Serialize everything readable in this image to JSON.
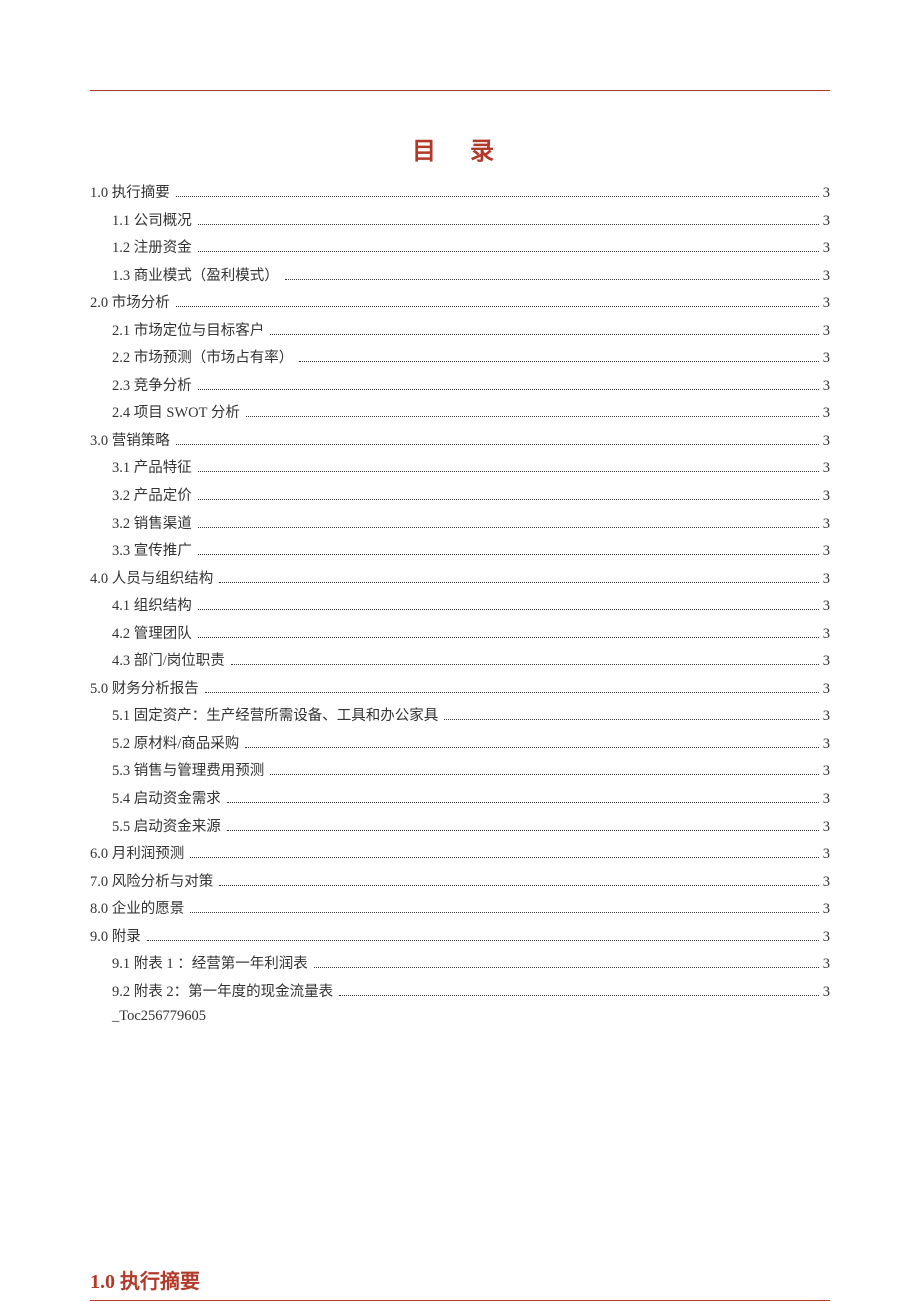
{
  "title": "目 录",
  "toc": [
    {
      "level": 1,
      "label": "1.0 执行摘要",
      "page": "3"
    },
    {
      "level": 2,
      "label": "1.1 公司概况",
      "page": "3"
    },
    {
      "level": 2,
      "label": "1.2 注册资金",
      "page": "3"
    },
    {
      "level": 2,
      "label": "1.3 商业模式（盈利模式）",
      "page": "3"
    },
    {
      "level": 1,
      "label": "2.0 市场分析",
      "page": "3"
    },
    {
      "level": 2,
      "label": "2.1 市场定位与目标客户",
      "page": "3"
    },
    {
      "level": 2,
      "label": "2.2 市场预测（市场占有率）",
      "page": "3"
    },
    {
      "level": 2,
      "label": "2.3 竞争分析",
      "page": "3"
    },
    {
      "level": 2,
      "label": "2.4 项目 SWOT 分析",
      "page": "3"
    },
    {
      "level": 1,
      "label": "3.0  营销策略",
      "page": "3"
    },
    {
      "level": 2,
      "label": "3.1 产品特征",
      "page": "3"
    },
    {
      "level": 2,
      "label": "3.2 产品定价",
      "page": "3"
    },
    {
      "level": 2,
      "label": "3.2 销售渠道",
      "page": "3"
    },
    {
      "level": 2,
      "label": "3.3 宣传推广",
      "page": "3"
    },
    {
      "level": 1,
      "label": "4.0 人员与组织结构",
      "page": "3"
    },
    {
      "level": 2,
      "label": "4.1 组织结构",
      "page": "3"
    },
    {
      "level": 2,
      "label": "4.2 管理团队",
      "page": "3"
    },
    {
      "level": 2,
      "label": "4.3 部门/岗位职责",
      "page": "3"
    },
    {
      "level": 1,
      "label": "5.0 财务分析报告",
      "page": "3"
    },
    {
      "level": 2,
      "label": "5.1 固定资产：生产经营所需设备、工具和办公家具",
      "page": "3"
    },
    {
      "level": 2,
      "label": "5.2 原材料/商品采购",
      "page": "3"
    },
    {
      "level": 2,
      "label": "5.3 销售与管理费用预测",
      "page": "3"
    },
    {
      "level": 2,
      "label": "5.4 启动资金需求",
      "page": "3"
    },
    {
      "level": 2,
      "label": "5.5 启动资金来源",
      "page": "3"
    },
    {
      "level": 1,
      "label": "6.0 月利润预测",
      "page": "3"
    },
    {
      "level": 1,
      "label": "7.0 风险分析与对策",
      "page": "3"
    },
    {
      "level": 1,
      "label": "8.0 企业的愿景",
      "page": "3"
    },
    {
      "level": 1,
      "label": "9.0 附录",
      "page": "3"
    },
    {
      "level": 2,
      "label": "9.1 附表 1 ：经营第一年利润表",
      "page": "3"
    },
    {
      "level": 2,
      "label": "9.2  附表 2：第一年度的现金流量表",
      "page": "3"
    }
  ],
  "bookmark": "_Toc256779605",
  "section_heading": "1.0 执行摘要"
}
